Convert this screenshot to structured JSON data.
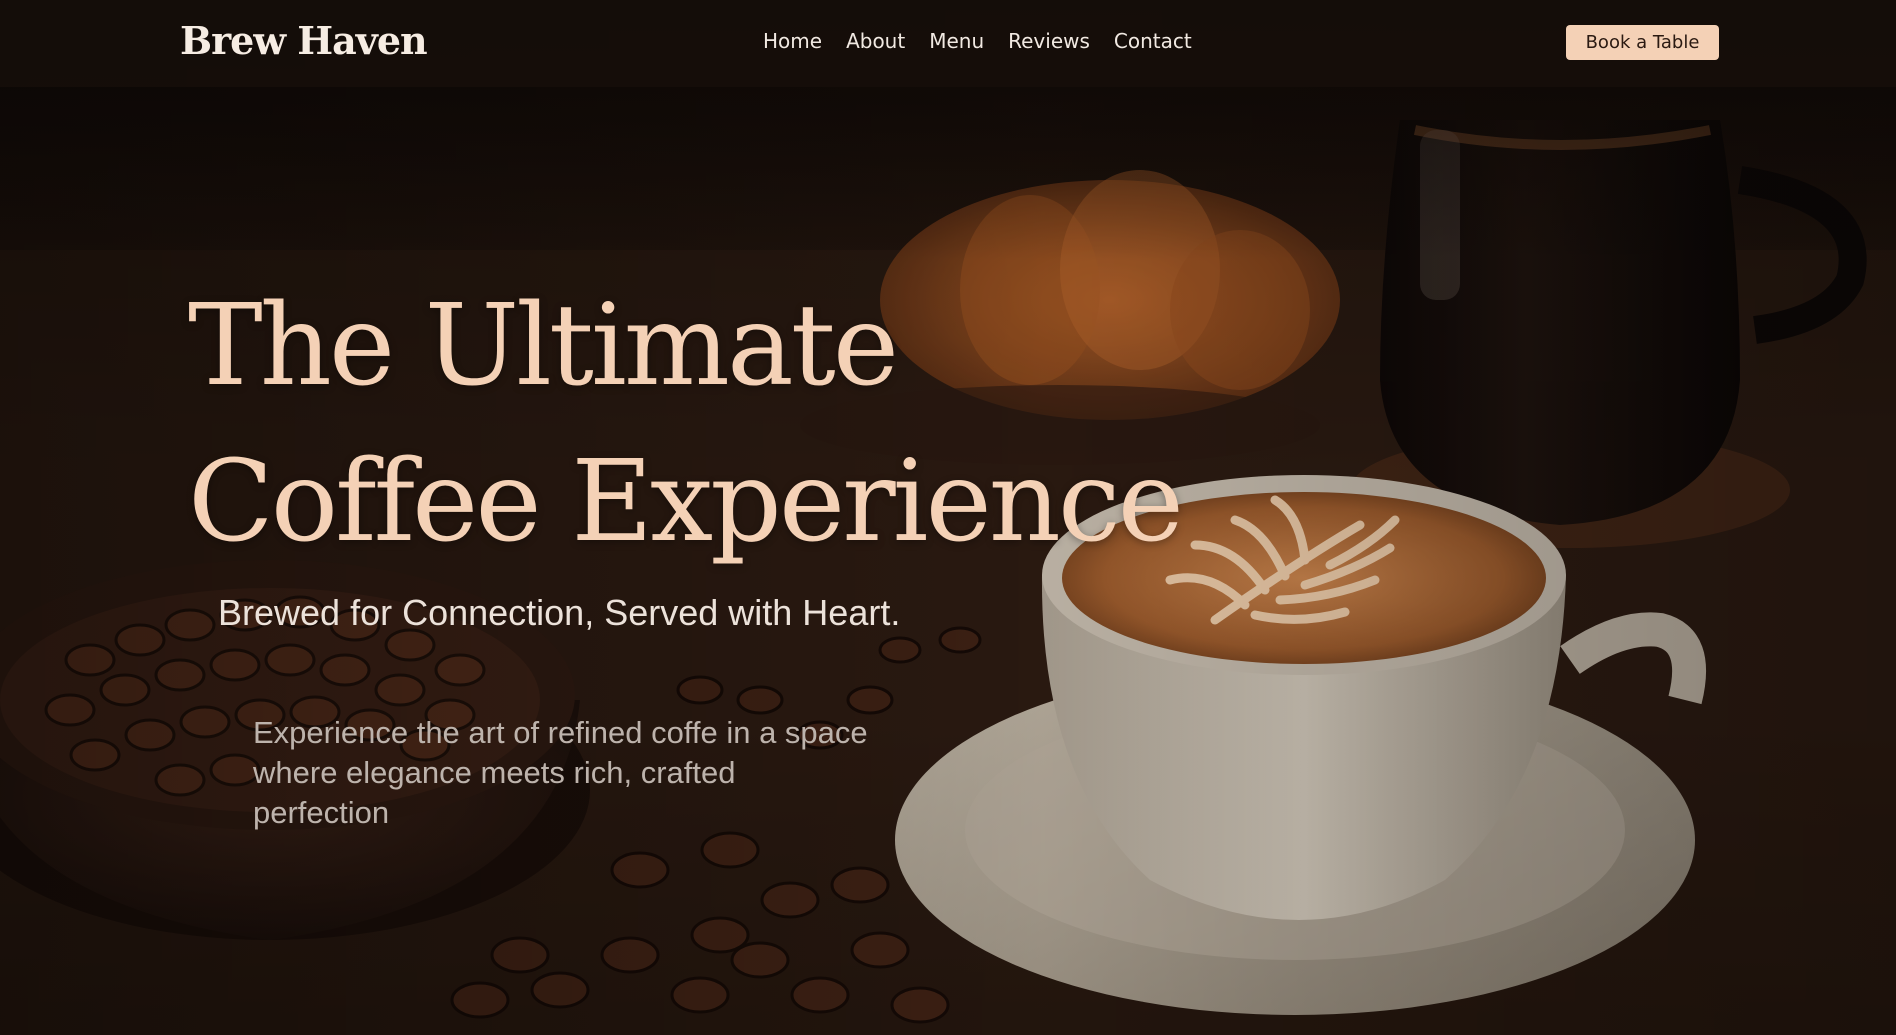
{
  "site": {
    "brand": "Brew Haven"
  },
  "nav": {
    "links": [
      {
        "label": "Home"
      },
      {
        "label": "About"
      },
      {
        "label": "Menu"
      },
      {
        "label": "Reviews"
      },
      {
        "label": "Contact"
      }
    ],
    "cta_label": "Book a Table"
  },
  "hero": {
    "title_line_1": "The Ultimate",
    "title_line_2": "Coffee Experience",
    "tagline": "Brewed for Connection, Served with Heart.",
    "description": "Experience the art of refined coffe in a space where elegance meets rich, crafted perfection"
  },
  "colors": {
    "accent": "#f4d1b6",
    "navbar": "#160e0a",
    "text_light": "#f1e9e2",
    "text_muted": "#bdb3ac"
  }
}
